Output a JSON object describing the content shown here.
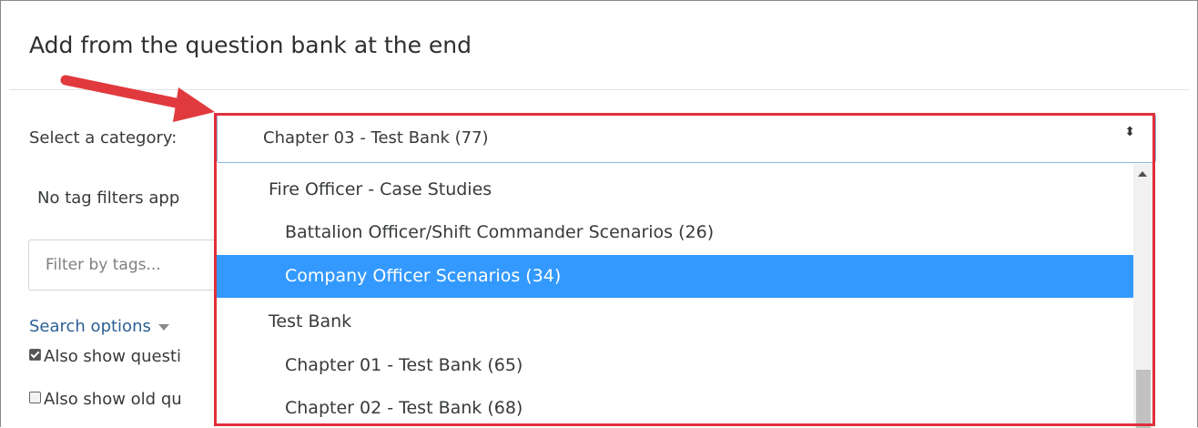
{
  "dialog": {
    "title": "Add from the question bank at the end"
  },
  "category": {
    "label": "Select a category:",
    "selected": "Chapter 03 - Test Bank (77)",
    "caret": "⬍"
  },
  "tags": {
    "status_text": "No tag filters app",
    "filter_placeholder": "Filter by tags..."
  },
  "search": {
    "options_label": "Search options",
    "show_questions_label": "Also show questi",
    "show_questions_checked": true,
    "show_old_label": "Also show old qu",
    "show_old_checked": false
  },
  "dropdown": {
    "options": [
      {
        "label": "Fire Officer - Case Studies",
        "level": "group",
        "selected": false
      },
      {
        "label": "Battalion Officer/Shift Commander Scenarios (26)",
        "level": "child",
        "selected": false
      },
      {
        "label": "Company Officer Scenarios (34)",
        "level": "child",
        "selected": true
      },
      {
        "label": "Test Bank",
        "level": "group",
        "selected": false
      },
      {
        "label": "Chapter 01 - Test Bank (65)",
        "level": "child",
        "selected": false
      },
      {
        "label": "Chapter 02 - Test Bank (68)",
        "level": "child",
        "selected": false
      }
    ]
  },
  "colors": {
    "highlight": "#e02f3a",
    "selection": "#3399ff",
    "link": "#2b5f94"
  }
}
